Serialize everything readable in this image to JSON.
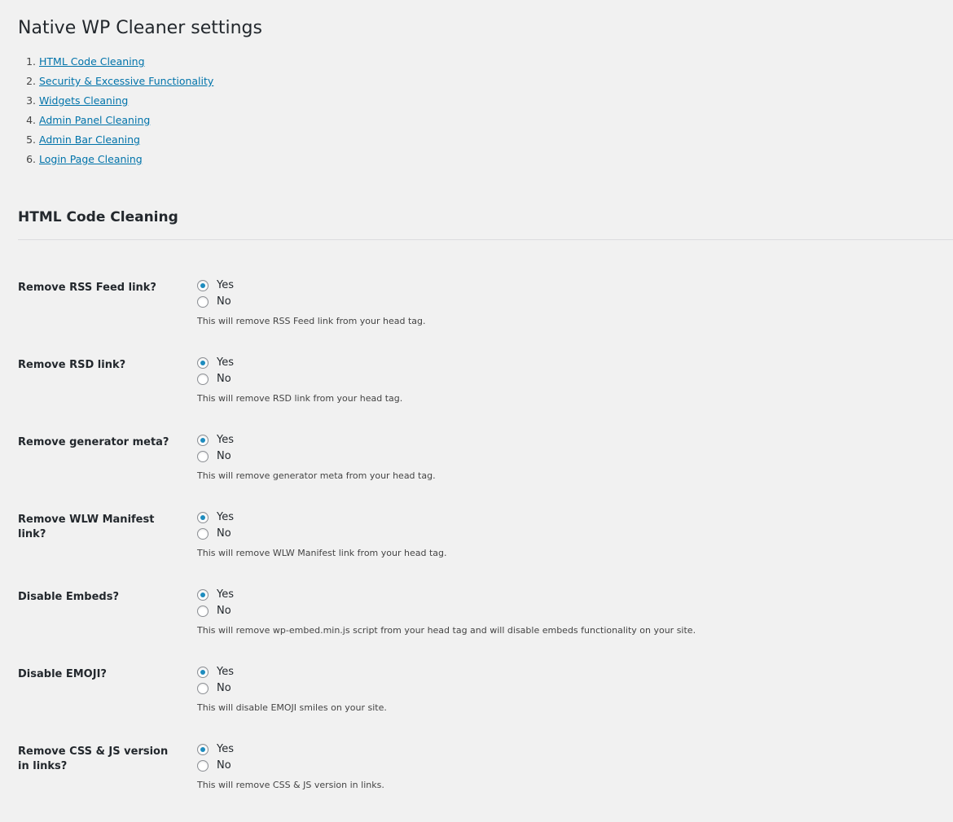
{
  "page": {
    "title": "Native WP Cleaner settings"
  },
  "toc": [
    {
      "number": "1.",
      "label": "HTML Code Cleaning"
    },
    {
      "number": "2.",
      "label": "Security & Excessive Functionality"
    },
    {
      "number": "3.",
      "label": "Widgets Cleaning"
    },
    {
      "number": "4.",
      "label": "Admin Panel Cleaning"
    },
    {
      "number": "5.",
      "label": "Admin Bar Cleaning"
    },
    {
      "number": "6.",
      "label": "Login Page Cleaning"
    }
  ],
  "section": {
    "title": "HTML Code Cleaning"
  },
  "options": {
    "yes_label": "Yes",
    "no_label": "No"
  },
  "settings": [
    {
      "label": "Remove RSS Feed link?",
      "selected": "Yes",
      "description": "This will remove RSS Feed link from your head tag."
    },
    {
      "label": "Remove RSD link?",
      "selected": "Yes",
      "description": "This will remove RSD link from your head tag."
    },
    {
      "label": "Remove generator meta?",
      "selected": "Yes",
      "description": "This will remove generator meta from your head tag."
    },
    {
      "label": "Remove WLW Manifest link?",
      "selected": "Yes",
      "description": "This will remove WLW Manifest link from your head tag."
    },
    {
      "label": "Disable Embeds?",
      "selected": "Yes",
      "description": "This will remove wp-embed.min.js script from your head tag and will disable embeds functionality on your site."
    },
    {
      "label": "Disable EMOJI?",
      "selected": "Yes",
      "description": "This will disable EMOJI smiles on your site."
    },
    {
      "label": "Remove CSS & JS version in links?",
      "selected": "Yes",
      "description": "This will remove CSS & JS version in links."
    }
  ],
  "colors": {
    "link": "#0073aa",
    "radio_checked": "#1e8cbe",
    "background": "#f1f1f1"
  }
}
